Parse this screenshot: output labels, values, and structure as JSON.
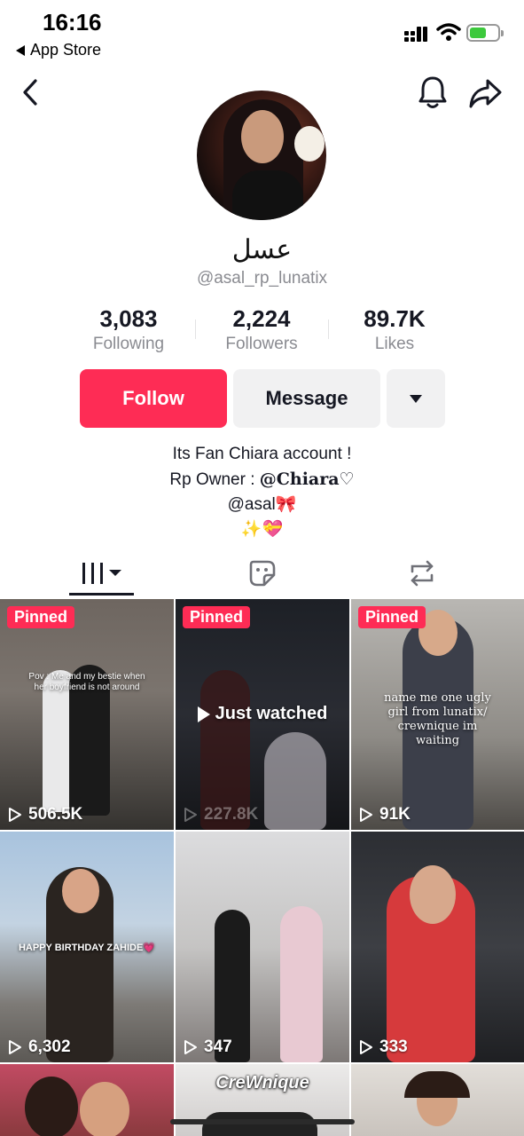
{
  "status_bar": {
    "time": "16:16",
    "back_app": "App Store"
  },
  "profile": {
    "display_name": "عسل",
    "handle": "@asal_rp_lunatix",
    "stats": [
      {
        "value": "3,083",
        "label": "Following"
      },
      {
        "value": "2,224",
        "label": "Followers"
      },
      {
        "value": "89.7K",
        "label": "Likes"
      }
    ],
    "buttons": {
      "follow": "Follow",
      "message": "Message"
    },
    "bio": {
      "line1": "Its Fan Chiara account !",
      "line2_prefix": "Rp Owner : ",
      "line2_mention": "@Chiara♡",
      "line3": "@asal🎀",
      "line4": "✨💝"
    }
  },
  "videos": [
    {
      "pinned": "Pinned",
      "views": "506.5K",
      "caption": "Pov : Me and my bestie when her boyfriend is not around"
    },
    {
      "pinned": "Pinned",
      "views": "227.8K",
      "overlay": "Just watched"
    },
    {
      "pinned": "Pinned",
      "views": "91K",
      "caption": "name me one ugly girl from lunatix/ crewnique im waiting"
    },
    {
      "views": "6,302",
      "caption": "HAPPY BIRTHDAY ZAHIDE💗"
    },
    {
      "views": "347"
    },
    {
      "views": "333"
    },
    {},
    {
      "caption": "CreWnique"
    },
    {}
  ],
  "colors": {
    "accent": "#fe2c55",
    "text": "#161823",
    "muted": "#8a8b91"
  }
}
